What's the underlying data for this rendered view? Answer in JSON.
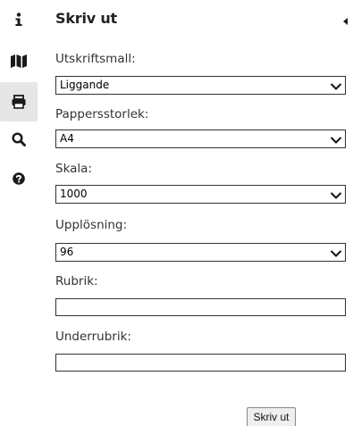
{
  "toolbar": {
    "items": [
      {
        "name": "info",
        "icon": "info-icon"
      },
      {
        "name": "map",
        "icon": "map-icon"
      },
      {
        "name": "print",
        "icon": "printer-icon",
        "active": true
      },
      {
        "name": "search",
        "icon": "search-icon"
      },
      {
        "name": "help",
        "icon": "help-icon"
      }
    ]
  },
  "panel": {
    "title": "Skriv ut",
    "collapse_icon": "collapse-left-icon"
  },
  "form": {
    "template": {
      "label": "Utskriftsmall:",
      "value": "Liggande"
    },
    "paper_size": {
      "label": "Pappersstorlek:",
      "value": "A4"
    },
    "scale": {
      "label": "Skala:",
      "value": "1000"
    },
    "resolution": {
      "label": "Upplösning:",
      "value": "96"
    },
    "title": {
      "label": "Rubrik:",
      "value": ""
    },
    "subtitle": {
      "label": "Underrubrik:",
      "value": ""
    },
    "submit_label": "Skriv ut"
  },
  "colors": {
    "text": "#333333",
    "border": "#333333",
    "active_tool_bg": "#e6e6e6",
    "button_bg": "#efefef"
  }
}
